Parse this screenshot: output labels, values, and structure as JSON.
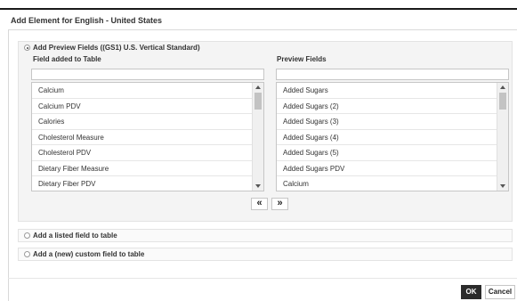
{
  "dialog": {
    "title": "Add Element for English - United States"
  },
  "options": {
    "preview": {
      "label": "Add Preview Fields ((GS1) U.S. Vertical Standard)",
      "selected": true
    },
    "listed": {
      "label": "Add a listed field to table",
      "selected": false
    },
    "custom": {
      "label": "Add a (new) custom field to table",
      "selected": false
    }
  },
  "left_list": {
    "header": "Field added to Table",
    "filter_value": "",
    "items": [
      "Calcium",
      "Calcium PDV",
      "Calories",
      "Cholesterol Measure",
      "Cholesterol PDV",
      "Dietary Fiber Measure",
      "Dietary Fiber PDV"
    ]
  },
  "right_list": {
    "header": "Preview Fields",
    "filter_value": "",
    "items": [
      "Added Sugars",
      "Added Sugars (2)",
      "Added Sugars (3)",
      "Added Sugars (4)",
      "Added Sugars (5)",
      "Added Sugars PDV",
      "Calcium"
    ]
  },
  "move_buttons": {
    "move_left": "«",
    "move_right": "»"
  },
  "footer": {
    "ok_label": "OK",
    "cancel_label": "Cancel"
  },
  "icons": {
    "scroll_up": "triangle-up",
    "scroll_down": "triangle-down"
  },
  "colors": {
    "ok_background": "#2b2b2b",
    "panel_background": "#f4f4f4"
  }
}
